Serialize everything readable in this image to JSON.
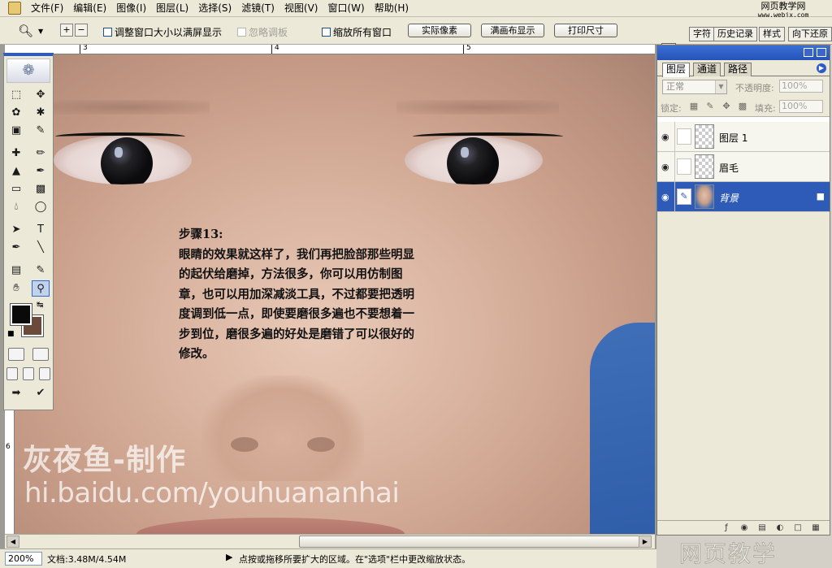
{
  "menu": {
    "items": [
      "文件(F)",
      "编辑(E)",
      "图像(I)",
      "图层(L)",
      "选择(S)",
      "滤镜(T)",
      "视图(V)",
      "窗口(W)",
      "帮助(H)"
    ]
  },
  "site_badge": {
    "title": "网页教学网",
    "url": "www.webjx.com"
  },
  "options": {
    "tool_icon": "zoom-icon",
    "check_resize": "调整窗口大小以满屏显示",
    "check_ignore": "忽略调板",
    "check_zoom_all": "缩放所有窗口",
    "btn_actual": "实际像素",
    "btn_fit": "满画布显示",
    "btn_print": "打印尺寸",
    "well_tabs": [
      "字符",
      "历史记录",
      "样式",
      "向下还原"
    ]
  },
  "ruler": {
    "top_labels": [
      "3",
      "4",
      "5"
    ],
    "left_labels": [
      "6"
    ]
  },
  "canvas": {
    "step_title": "步骤13:",
    "step_body": "眼睛的效果就这样了，我们再把脸部那些明显的起伏给磨掉，方法很多，你可以用仿制图章，也可以用加深减淡工具，不过都要把透明度调到低一点，即使要磨很多遍也不要想着一步到位，磨很多遍的好处是磨错了可以很好的修改。",
    "watermark_author": "灰夜鱼-制作",
    "watermark_url": "hi.baidu.com/youhuananhai"
  },
  "status": {
    "zoom": "200%",
    "doc_size": "文档:3.48M/4.54M",
    "hint": "点按或拖移所要扩大的区域。在\"选项\"栏中更改缩放状态。"
  },
  "toolbox": {
    "colors": {
      "foreground": "#0a0a0a",
      "background": "#6b4a3a"
    }
  },
  "layers": {
    "tabs": [
      "图层",
      "通道",
      "路径"
    ],
    "blend_mode": "正常",
    "opacity_label": "不透明度:",
    "opacity_value": "100%",
    "lock_label": "锁定:",
    "fill_label": "填充:",
    "fill_value": "100%",
    "items": [
      {
        "name": "图层 1",
        "selected": false
      },
      {
        "name": "眉毛",
        "selected": false
      },
      {
        "name": "背景",
        "selected": true,
        "locked": true
      }
    ]
  },
  "colors": {
    "selection": "#2e5bb7",
    "titlebar": "#2a5bc7",
    "accent_blue_shirt": "#3f6fb8"
  },
  "corner_logo": "网页教学"
}
